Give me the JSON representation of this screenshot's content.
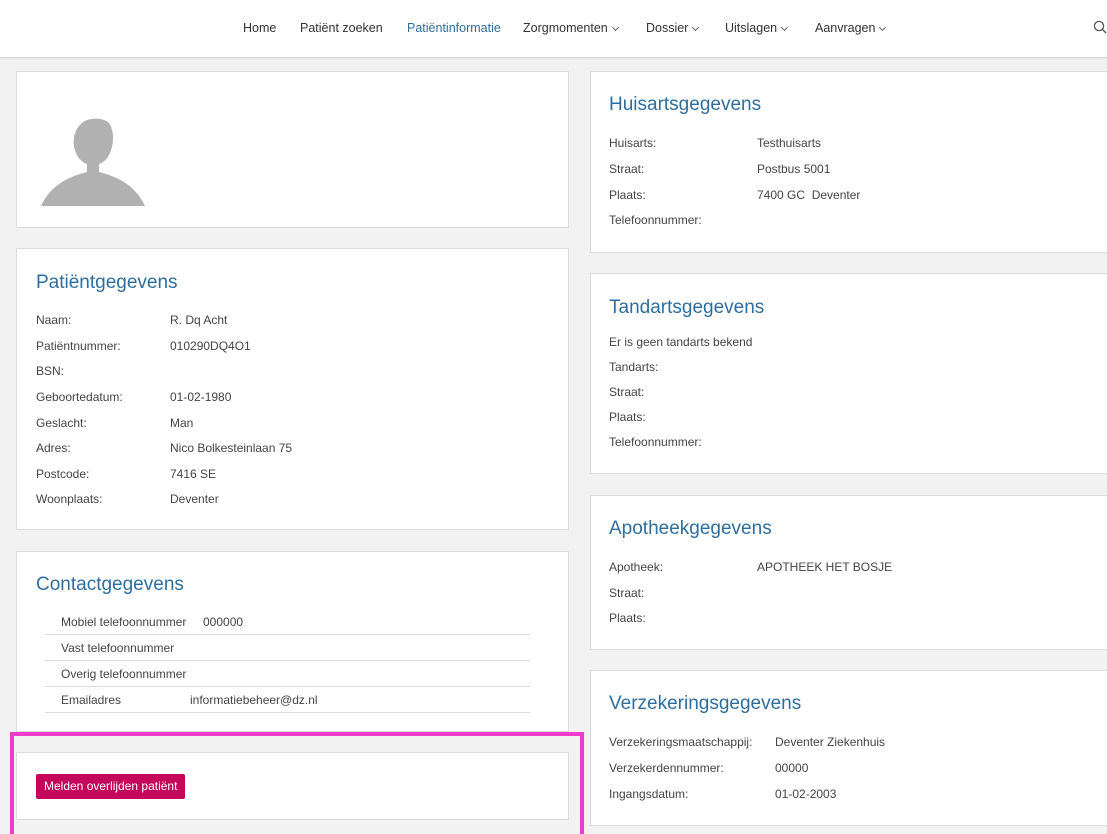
{
  "nav": {
    "items": [
      {
        "label": "Home"
      },
      {
        "label": "Patiënt zoeken"
      },
      {
        "label": "Patiëntinformatie",
        "active": true
      },
      {
        "label": "Zorgmomenten",
        "dropdown": true
      },
      {
        "label": "Dossier",
        "dropdown": true
      },
      {
        "label": "Uitslagen",
        "dropdown": true
      },
      {
        "label": "Aanvragen",
        "dropdown": true
      }
    ],
    "search_icon": "search-icon"
  },
  "patient": {
    "title": "Patiëntgegevens",
    "rows": [
      {
        "label": "Naam:",
        "value": "R. Dq Acht"
      },
      {
        "label": "Patiëntnummer:",
        "value": "010290DQ4O1"
      },
      {
        "label": "BSN:",
        "value": ""
      },
      {
        "label": "Geboortedatum:",
        "value": "01-02-1980"
      },
      {
        "label": "Geslacht:",
        "value": "Man"
      },
      {
        "label": "Adres:",
        "value": "Nico Bolkesteinlaan 75"
      },
      {
        "label": "Postcode:",
        "value": "7416 SE"
      },
      {
        "label": "Woonplaats:",
        "value": "Deventer"
      }
    ]
  },
  "contact": {
    "title": "Contactgegevens",
    "rows": [
      {
        "label": "Mobiel telefoonnummer",
        "value": "000000"
      },
      {
        "label": "Vast telefoonnummer",
        "value": ""
      },
      {
        "label": "Overig telefoonnummer",
        "value": ""
      },
      {
        "label": "Emailadres",
        "value": "informatiebeheer@dz.nl"
      }
    ]
  },
  "actions": {
    "report_death_label": "Melden overlijden patiënt"
  },
  "huisarts": {
    "title": "Huisartsgegevens",
    "rows": [
      {
        "label": "Huisarts:",
        "value": "Testhuisarts"
      },
      {
        "label": "Straat:",
        "value": "Postbus 5001"
      },
      {
        "label": "Plaats:",
        "value": "7400 GC  Deventer"
      },
      {
        "label": "Telefoonnummer:",
        "value": ""
      }
    ]
  },
  "tandarts": {
    "title": "Tandartsgegevens",
    "notice": "Er is geen tandarts bekend",
    "rows": [
      {
        "label": "Tandarts:",
        "value": ""
      },
      {
        "label": "Straat:",
        "value": ""
      },
      {
        "label": "Plaats:",
        "value": ""
      },
      {
        "label": "Telefoonnummer:",
        "value": ""
      }
    ]
  },
  "apotheek": {
    "title": "Apotheekgegevens",
    "rows": [
      {
        "label": "Apotheek:",
        "value": "APOTHEEK HET BOSJE"
      },
      {
        "label": "Straat:",
        "value": ""
      },
      {
        "label": "Plaats:",
        "value": ""
      }
    ]
  },
  "verzekering": {
    "title": "Verzekeringsgegevens",
    "rows": [
      {
        "label": "Verzekeringsmaatschappij:",
        "value": "Deventer Ziekenhuis"
      },
      {
        "label": "Verzekerdennummer:",
        "value": "00000"
      },
      {
        "label": "Ingangsdatum:",
        "value": "01-02-2003"
      }
    ]
  },
  "colors": {
    "accent": "#2e6e9e",
    "danger_button": "#c4075a",
    "highlight": "#f03ccc"
  }
}
